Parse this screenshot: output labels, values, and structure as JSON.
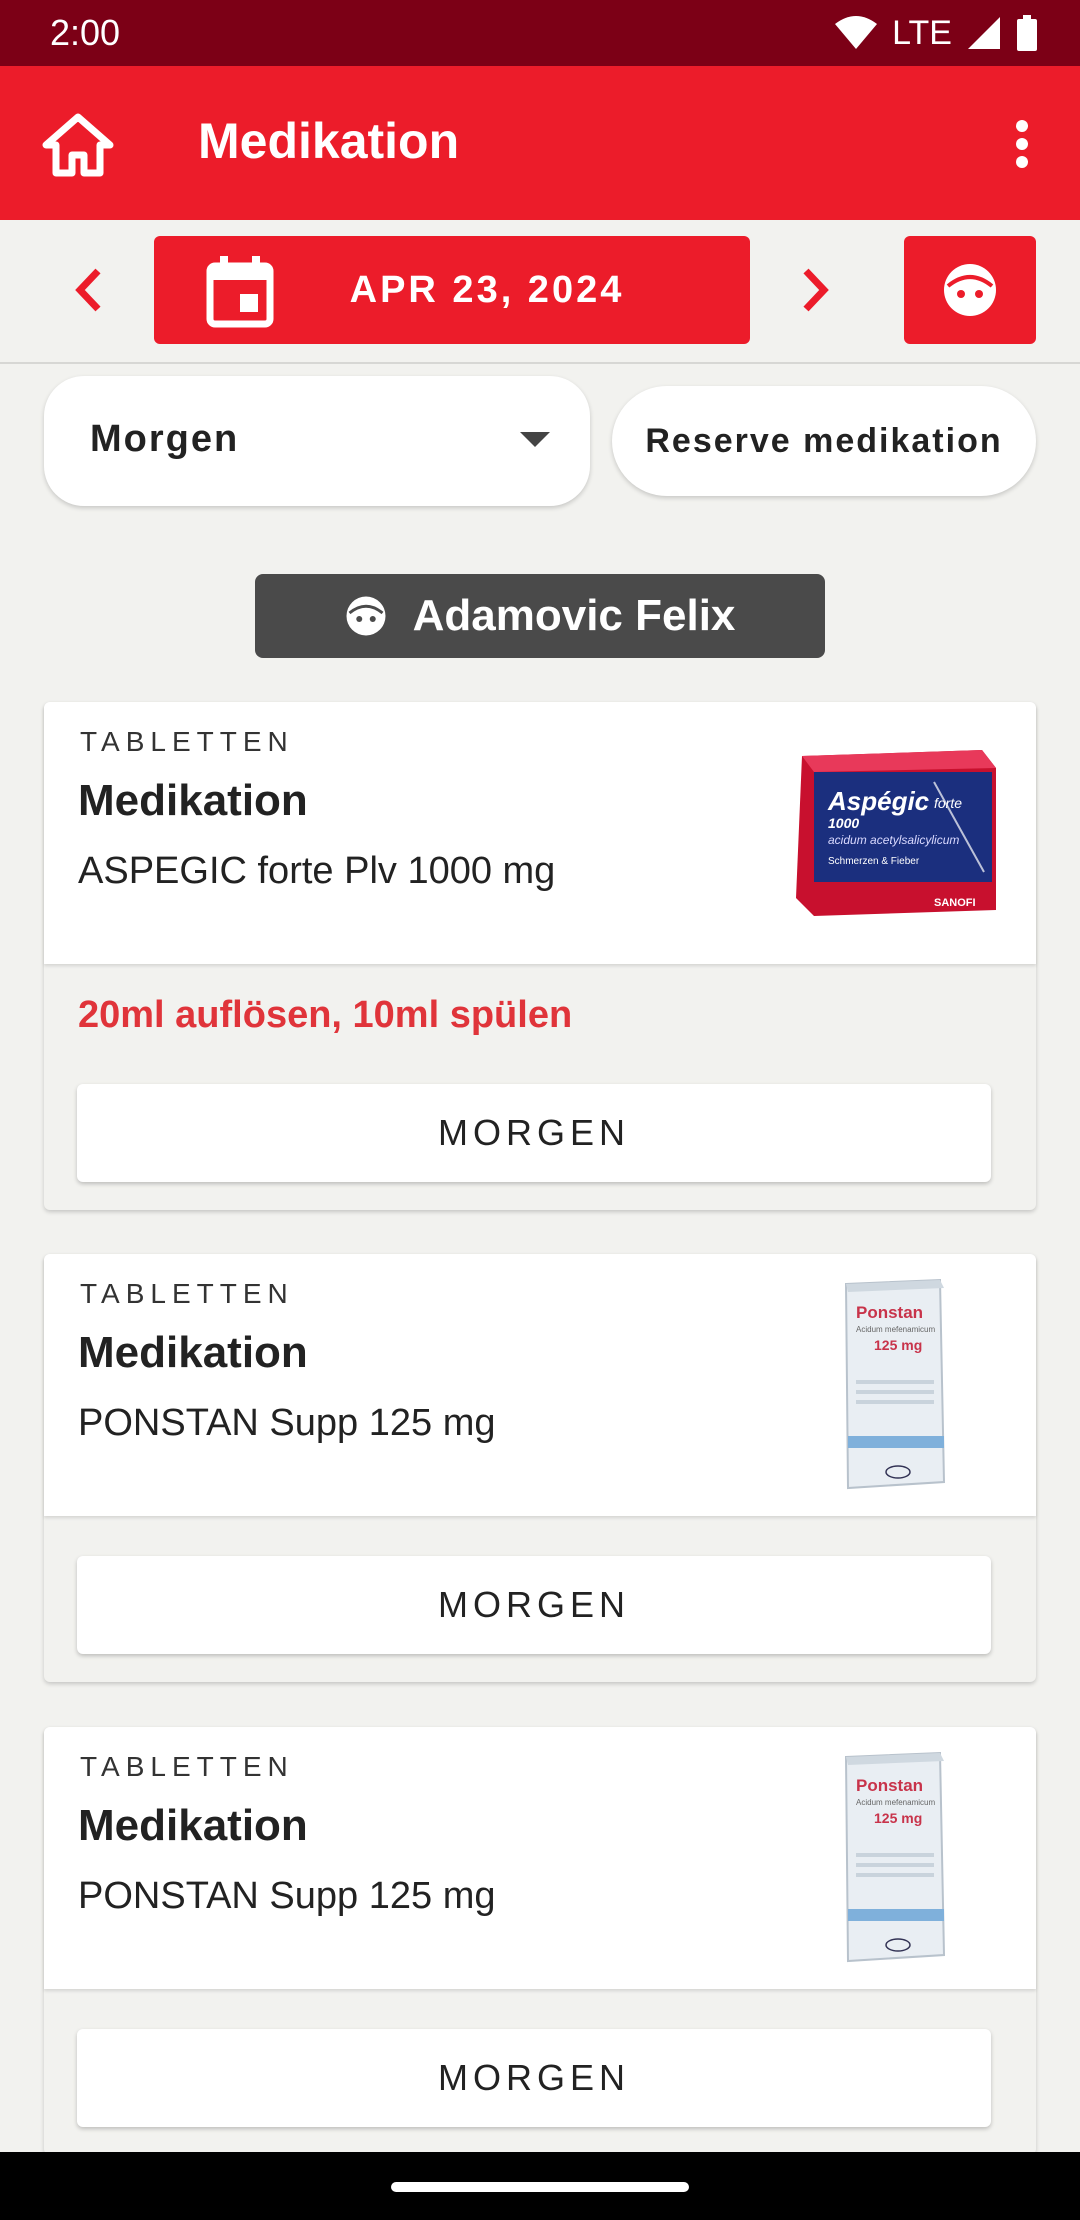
{
  "status": {
    "time": "2:00",
    "network": "LTE"
  },
  "app_bar": {
    "title": "Medikation"
  },
  "date_nav": {
    "date": "APR 23, 2024"
  },
  "filters": {
    "time_of_day": "Morgen",
    "reserve_label": "Reserve medikation"
  },
  "patient": {
    "name": "Adamovic Felix"
  },
  "colors": {
    "primary": "#ec1c2a",
    "status_bar": "#7c0016",
    "note": "#e0343a",
    "chip": "#4a4a4a"
  },
  "medications": [
    {
      "type": "TABLETTEN",
      "title": "Medikation",
      "name": "ASPEGIC forte Plv 1000 mg",
      "note": "20ml auflösen, 10ml spülen",
      "button": "MORGEN",
      "image": {
        "brand": "Aspégic",
        "sub": "forte",
        "dose": "1000",
        "line": "acidum acetylsalicylicum",
        "desc": "Schmerzen & Fieber",
        "maker": "SANOFI"
      }
    },
    {
      "type": "TABLETTEN",
      "title": "Medikation",
      "name": "PONSTAN Supp 125 mg",
      "note": "",
      "button": "MORGEN",
      "image": {
        "brand": "Ponstan",
        "sub": "Acidum mefenamicum",
        "dose": "125 mg"
      }
    },
    {
      "type": "TABLETTEN",
      "title": "Medikation",
      "name": "PONSTAN Supp 125 mg",
      "note": "",
      "button": "MORGEN",
      "image": {
        "brand": "Ponstan",
        "sub": "Acidum mefenamicum",
        "dose": "125 mg"
      }
    }
  ]
}
